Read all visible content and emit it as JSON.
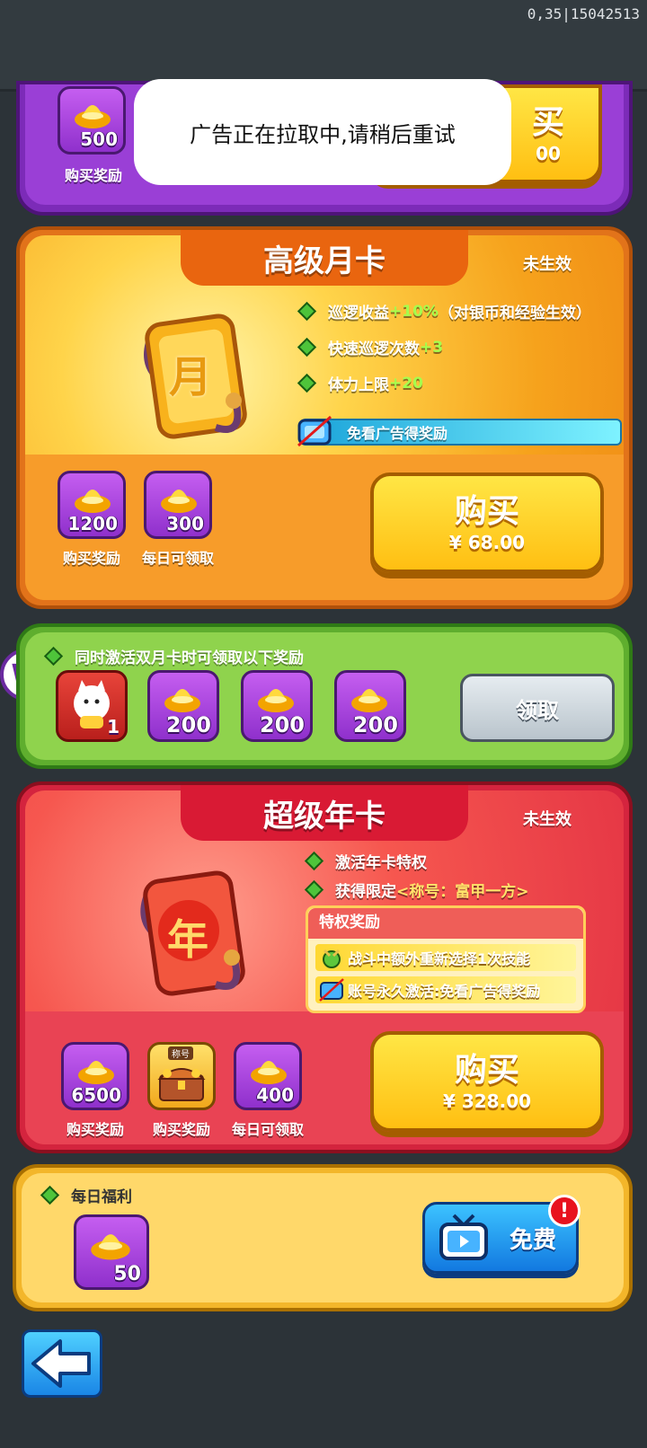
{
  "debug_text": "0,35|15042513",
  "toast": "广告正在拉取中,请稍后重试",
  "top_card": {
    "gold_count": "500",
    "gold_label": "购买奖励",
    "buy_label_partial": "买",
    "price_partial": "00"
  },
  "monthly_card": {
    "title": "高级月卡",
    "status": "未生效",
    "perks": [
      {
        "text": "巡逻收益",
        "bonus": "+10%",
        "suffix": "（对银币和经验生效）"
      },
      {
        "text": "快速巡逻次数",
        "bonus": "+3",
        "suffix": ""
      },
      {
        "text": "体力上限",
        "bonus": "+20",
        "suffix": ""
      }
    ],
    "ad_free": "免看广告得奖励",
    "icon_char": "月",
    "rewards": [
      {
        "count": "1200",
        "label": "购买奖励"
      },
      {
        "count": "300",
        "label": "每日可领取"
      }
    ],
    "buy_label": "购买",
    "price": "¥ 68.00"
  },
  "dual_card": {
    "header": "同时激活双月卡时可领取以下奖励",
    "rewards": [
      "1",
      "200",
      "200",
      "200"
    ],
    "claim_label": "领取"
  },
  "annual_card": {
    "title": "超级年卡",
    "status": "未生效",
    "perks": [
      {
        "text": "激活年卡特权",
        "highlight": ""
      },
      {
        "text": "获得限定",
        "highlight": "<称号：富甲一方>"
      }
    ],
    "privilege_title": "特权奖励",
    "privileges": [
      "战斗中额外重新选择1次技能",
      "账号永久激活:免看广告得奖励"
    ],
    "icon_char": "年",
    "rewards": [
      {
        "count": "6500",
        "label": "购买奖励"
      },
      {
        "count": "",
        "label": "购买奖励",
        "badge": "称号"
      },
      {
        "count": "400",
        "label": "每日可领取"
      }
    ],
    "buy_label": "购买",
    "price": "¥ 328.00"
  },
  "daily": {
    "header": "每日福利",
    "count": "50",
    "free_label": "免费",
    "alert": "!"
  },
  "colors": {
    "gold": "#ffd24a",
    "green_accent": "#a6ff4d",
    "yellow_text": "#ffe36a"
  }
}
